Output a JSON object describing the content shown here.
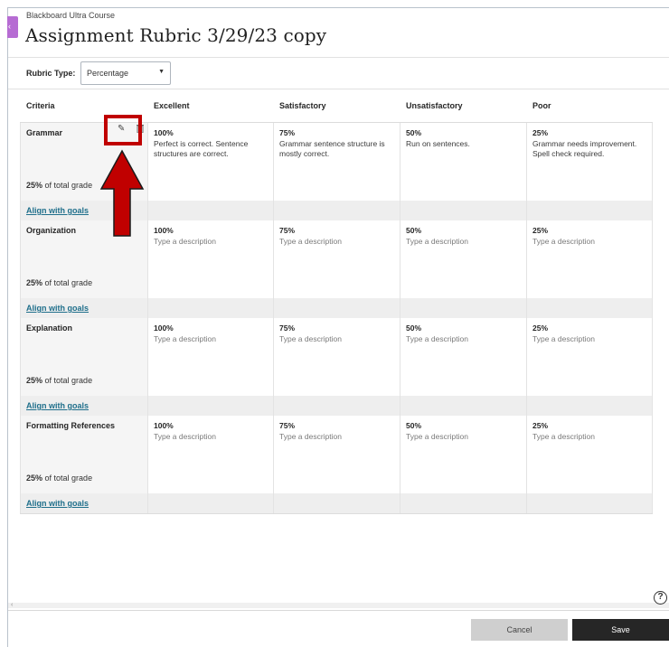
{
  "header": {
    "course_name": "Blackboard Ultra Course",
    "title": "Assignment Rubric 3/29/23 copy"
  },
  "rubric_type": {
    "label": "Rubric Type:",
    "value": "Percentage"
  },
  "columns": [
    "Criteria",
    "Excellent",
    "Satisfactory",
    "Unsatisfactory",
    "Poor"
  ],
  "criteria": [
    {
      "name": "Grammar",
      "weight": "25%",
      "weight_suffix": "of total grade",
      "align": "Align with goals",
      "levels": [
        {
          "value": "100%",
          "desc": "Perfect is correct. Sentence structures are correct."
        },
        {
          "value": "75%",
          "desc": "Grammar sentence structure is mostly correct."
        },
        {
          "value": "50%",
          "desc": "Run on sentences."
        },
        {
          "value": "25%",
          "desc": "Grammar needs improvement. Spell check required."
        }
      ]
    },
    {
      "name": "Organization",
      "weight": "25%",
      "weight_suffix": "of total grade",
      "align": "Align with goals",
      "levels": [
        {
          "value": "100%",
          "desc": "Type a description"
        },
        {
          "value": "75%",
          "desc": "Type a description"
        },
        {
          "value": "50%",
          "desc": "Type a description"
        },
        {
          "value": "25%",
          "desc": "Type a description"
        }
      ]
    },
    {
      "name": "Explanation",
      "weight": "25%",
      "weight_suffix": "of total grade",
      "align": "Align with goals",
      "levels": [
        {
          "value": "100%",
          "desc": "Type a description"
        },
        {
          "value": "75%",
          "desc": "Type a description"
        },
        {
          "value": "50%",
          "desc": "Type a description"
        },
        {
          "value": "25%",
          "desc": "Type a description"
        }
      ]
    },
    {
      "name": "Formatting References",
      "weight": "25%",
      "weight_suffix": "of total grade",
      "align": "Align with goals",
      "levels": [
        {
          "value": "100%",
          "desc": "Type a description"
        },
        {
          "value": "75%",
          "desc": "Type a description"
        },
        {
          "value": "50%",
          "desc": "Type a description"
        },
        {
          "value": "25%",
          "desc": "Type a description"
        }
      ]
    }
  ],
  "footer": {
    "cancel_label": "Cancel",
    "save_label": "Save"
  },
  "icons": {
    "edit": "pencil-icon",
    "delete": "trash-icon",
    "help": "help-icon",
    "dropdown": "caret-down-icon"
  },
  "colors": {
    "annotation_red": "#c00000",
    "link": "#1f6f8b",
    "save_button": "#262626",
    "course_tab": "#b66cd3"
  }
}
